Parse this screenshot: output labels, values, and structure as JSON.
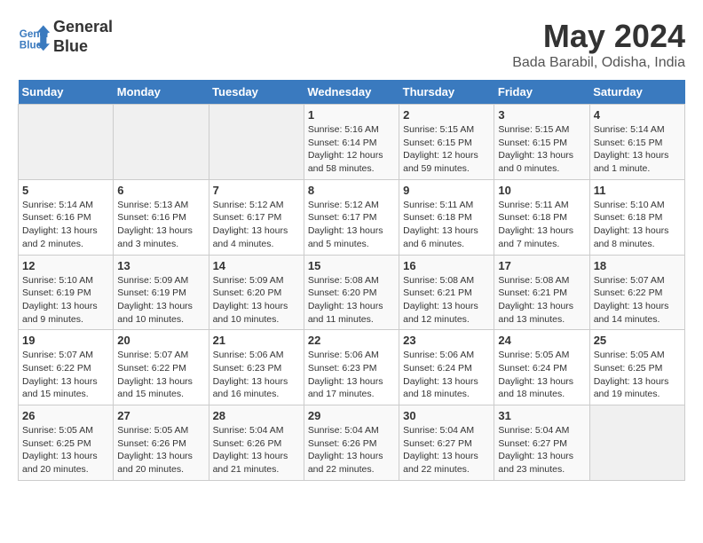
{
  "header": {
    "logo_line1": "General",
    "logo_line2": "Blue",
    "title": "May 2024",
    "subtitle": "Bada Barabil, Odisha, India"
  },
  "days_of_week": [
    "Sunday",
    "Monday",
    "Tuesday",
    "Wednesday",
    "Thursday",
    "Friday",
    "Saturday"
  ],
  "weeks": [
    [
      {
        "day": "",
        "info": ""
      },
      {
        "day": "",
        "info": ""
      },
      {
        "day": "",
        "info": ""
      },
      {
        "day": "1",
        "info": "Sunrise: 5:16 AM\nSunset: 6:14 PM\nDaylight: 12 hours\nand 58 minutes."
      },
      {
        "day": "2",
        "info": "Sunrise: 5:15 AM\nSunset: 6:15 PM\nDaylight: 12 hours\nand 59 minutes."
      },
      {
        "day": "3",
        "info": "Sunrise: 5:15 AM\nSunset: 6:15 PM\nDaylight: 13 hours\nand 0 minutes."
      },
      {
        "day": "4",
        "info": "Sunrise: 5:14 AM\nSunset: 6:15 PM\nDaylight: 13 hours\nand 1 minute."
      }
    ],
    [
      {
        "day": "5",
        "info": "Sunrise: 5:14 AM\nSunset: 6:16 PM\nDaylight: 13 hours\nand 2 minutes."
      },
      {
        "day": "6",
        "info": "Sunrise: 5:13 AM\nSunset: 6:16 PM\nDaylight: 13 hours\nand 3 minutes."
      },
      {
        "day": "7",
        "info": "Sunrise: 5:12 AM\nSunset: 6:17 PM\nDaylight: 13 hours\nand 4 minutes."
      },
      {
        "day": "8",
        "info": "Sunrise: 5:12 AM\nSunset: 6:17 PM\nDaylight: 13 hours\nand 5 minutes."
      },
      {
        "day": "9",
        "info": "Sunrise: 5:11 AM\nSunset: 6:18 PM\nDaylight: 13 hours\nand 6 minutes."
      },
      {
        "day": "10",
        "info": "Sunrise: 5:11 AM\nSunset: 6:18 PM\nDaylight: 13 hours\nand 7 minutes."
      },
      {
        "day": "11",
        "info": "Sunrise: 5:10 AM\nSunset: 6:18 PM\nDaylight: 13 hours\nand 8 minutes."
      }
    ],
    [
      {
        "day": "12",
        "info": "Sunrise: 5:10 AM\nSunset: 6:19 PM\nDaylight: 13 hours\nand 9 minutes."
      },
      {
        "day": "13",
        "info": "Sunrise: 5:09 AM\nSunset: 6:19 PM\nDaylight: 13 hours\nand 10 minutes."
      },
      {
        "day": "14",
        "info": "Sunrise: 5:09 AM\nSunset: 6:20 PM\nDaylight: 13 hours\nand 10 minutes."
      },
      {
        "day": "15",
        "info": "Sunrise: 5:08 AM\nSunset: 6:20 PM\nDaylight: 13 hours\nand 11 minutes."
      },
      {
        "day": "16",
        "info": "Sunrise: 5:08 AM\nSunset: 6:21 PM\nDaylight: 13 hours\nand 12 minutes."
      },
      {
        "day": "17",
        "info": "Sunrise: 5:08 AM\nSunset: 6:21 PM\nDaylight: 13 hours\nand 13 minutes."
      },
      {
        "day": "18",
        "info": "Sunrise: 5:07 AM\nSunset: 6:22 PM\nDaylight: 13 hours\nand 14 minutes."
      }
    ],
    [
      {
        "day": "19",
        "info": "Sunrise: 5:07 AM\nSunset: 6:22 PM\nDaylight: 13 hours\nand 15 minutes."
      },
      {
        "day": "20",
        "info": "Sunrise: 5:07 AM\nSunset: 6:22 PM\nDaylight: 13 hours\nand 15 minutes."
      },
      {
        "day": "21",
        "info": "Sunrise: 5:06 AM\nSunset: 6:23 PM\nDaylight: 13 hours\nand 16 minutes."
      },
      {
        "day": "22",
        "info": "Sunrise: 5:06 AM\nSunset: 6:23 PM\nDaylight: 13 hours\nand 17 minutes."
      },
      {
        "day": "23",
        "info": "Sunrise: 5:06 AM\nSunset: 6:24 PM\nDaylight: 13 hours\nand 18 minutes."
      },
      {
        "day": "24",
        "info": "Sunrise: 5:05 AM\nSunset: 6:24 PM\nDaylight: 13 hours\nand 18 minutes."
      },
      {
        "day": "25",
        "info": "Sunrise: 5:05 AM\nSunset: 6:25 PM\nDaylight: 13 hours\nand 19 minutes."
      }
    ],
    [
      {
        "day": "26",
        "info": "Sunrise: 5:05 AM\nSunset: 6:25 PM\nDaylight: 13 hours\nand 20 minutes."
      },
      {
        "day": "27",
        "info": "Sunrise: 5:05 AM\nSunset: 6:26 PM\nDaylight: 13 hours\nand 20 minutes."
      },
      {
        "day": "28",
        "info": "Sunrise: 5:04 AM\nSunset: 6:26 PM\nDaylight: 13 hours\nand 21 minutes."
      },
      {
        "day": "29",
        "info": "Sunrise: 5:04 AM\nSunset: 6:26 PM\nDaylight: 13 hours\nand 22 minutes."
      },
      {
        "day": "30",
        "info": "Sunrise: 5:04 AM\nSunset: 6:27 PM\nDaylight: 13 hours\nand 22 minutes."
      },
      {
        "day": "31",
        "info": "Sunrise: 5:04 AM\nSunset: 6:27 PM\nDaylight: 13 hours\nand 23 minutes."
      },
      {
        "day": "",
        "info": ""
      }
    ]
  ]
}
